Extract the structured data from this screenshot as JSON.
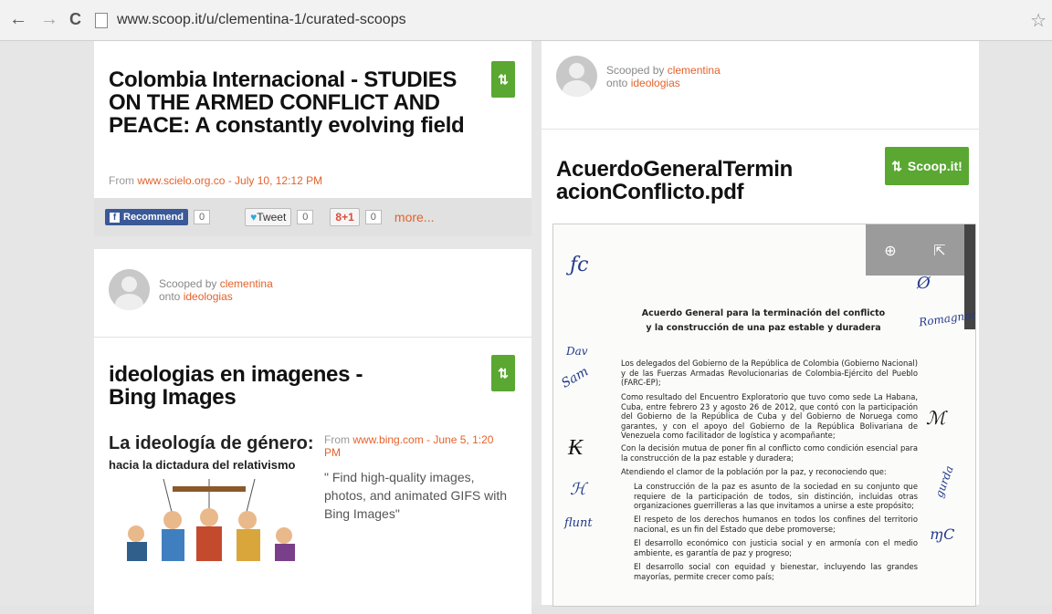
{
  "browser": {
    "url": "www.scoop.it/u/clementina-1/curated-scoops",
    "back_icon": "←",
    "forward_icon": "→",
    "reload_icon": "C",
    "star_icon": "☆"
  },
  "colors": {
    "accent": "#e4622b",
    "scoop_green": "#5aa732",
    "facebook": "#3b5998"
  },
  "left": {
    "post1": {
      "title": "Colombia Internacional - STUDIES ON THE ARMED CONFLICT AND PEACE: A constantly evolving field",
      "from_prefix": "From ",
      "from_site": "www.scielo.org.co",
      "from_date": " - July 10, 12:12 PM",
      "scoop_icon": "⇅"
    },
    "share": {
      "recommend_label": "Recommend",
      "recommend_count": "0",
      "tweet_label": "Tweet",
      "tweet_count": "0",
      "gplus_label": "8+1",
      "gplus_count": "0",
      "more_label": "more..."
    },
    "scooped": {
      "by_prefix": "Scooped by ",
      "user": "clementina",
      "onto_prefix": "onto ",
      "topic": "ideologias"
    },
    "post2": {
      "title": "ideologias en imagenes - Bing Images",
      "scoop_icon": "⇅",
      "book_title": "La ideología de género:",
      "book_subtitle": "hacia la dictadura del relativismo",
      "from_prefix": "From ",
      "from_site": "www.bing.com",
      "from_date": " - June 5, 1:20 PM",
      "description": "\" Find high-quality images, photos, and animated GIFS with Bing Images\""
    }
  },
  "right": {
    "scooped": {
      "by_prefix": "Scooped by ",
      "user": "clementina",
      "onto_prefix": "onto ",
      "topic": "ideologias"
    },
    "post": {
      "title": "AcuerdoGeneralTerminacionConflicto.pdf",
      "scoop_button_label": "Scoop.it!",
      "scoop_icon": "⇅"
    },
    "pdf": {
      "zoom_icon": "⊕",
      "open_icon": "⇱",
      "heading1": "Acuerdo General para la terminación del conflicto",
      "heading2": "y la construcción de una paz estable y duradera",
      "p1": "Los delegados del Gobierno de la República de Colombia (Gobierno Nacional) y de las Fuerzas Armadas Revolucionarias de Colombia-Ejército del Pueblo (FARC-EP);",
      "p2": "Como resultado del Encuentro Exploratorio que tuvo como sede La Habana, Cuba, entre febrero 23 y agosto 26 de 2012, que contó con la participación del Gobierno de la República de Cuba y del Gobierno de Noruega como garantes, y con el apoyo del Gobierno de la República Bolivariana de Venezuela como facilitador de logística y acompañante;",
      "p3": "Con la decisión mutua de poner fin al conflicto como condición esencial para la construcción de la paz estable y duradera;",
      "p4": "Atendiendo el clamor de la población por la paz, y reconociendo que:",
      "p5": "La construcción de la paz es asunto de la sociedad en su conjunto que requiere de la participación de todos, sin distinción, incluidas otras organizaciones guerrilleras a las que invitamos a unirse a este propósito;",
      "p6": "El respeto de los derechos humanos en todos los confines del territorio nacional, es un fin del Estado que debe promoverse;",
      "p7": "El desarrollo económico con justicia social y en armonía con el medio ambiente, es garantía de paz y progreso;",
      "p8": "El desarrollo social con equidad y bienestar, incluyendo las grandes mayorías, permite crecer como país;"
    }
  }
}
